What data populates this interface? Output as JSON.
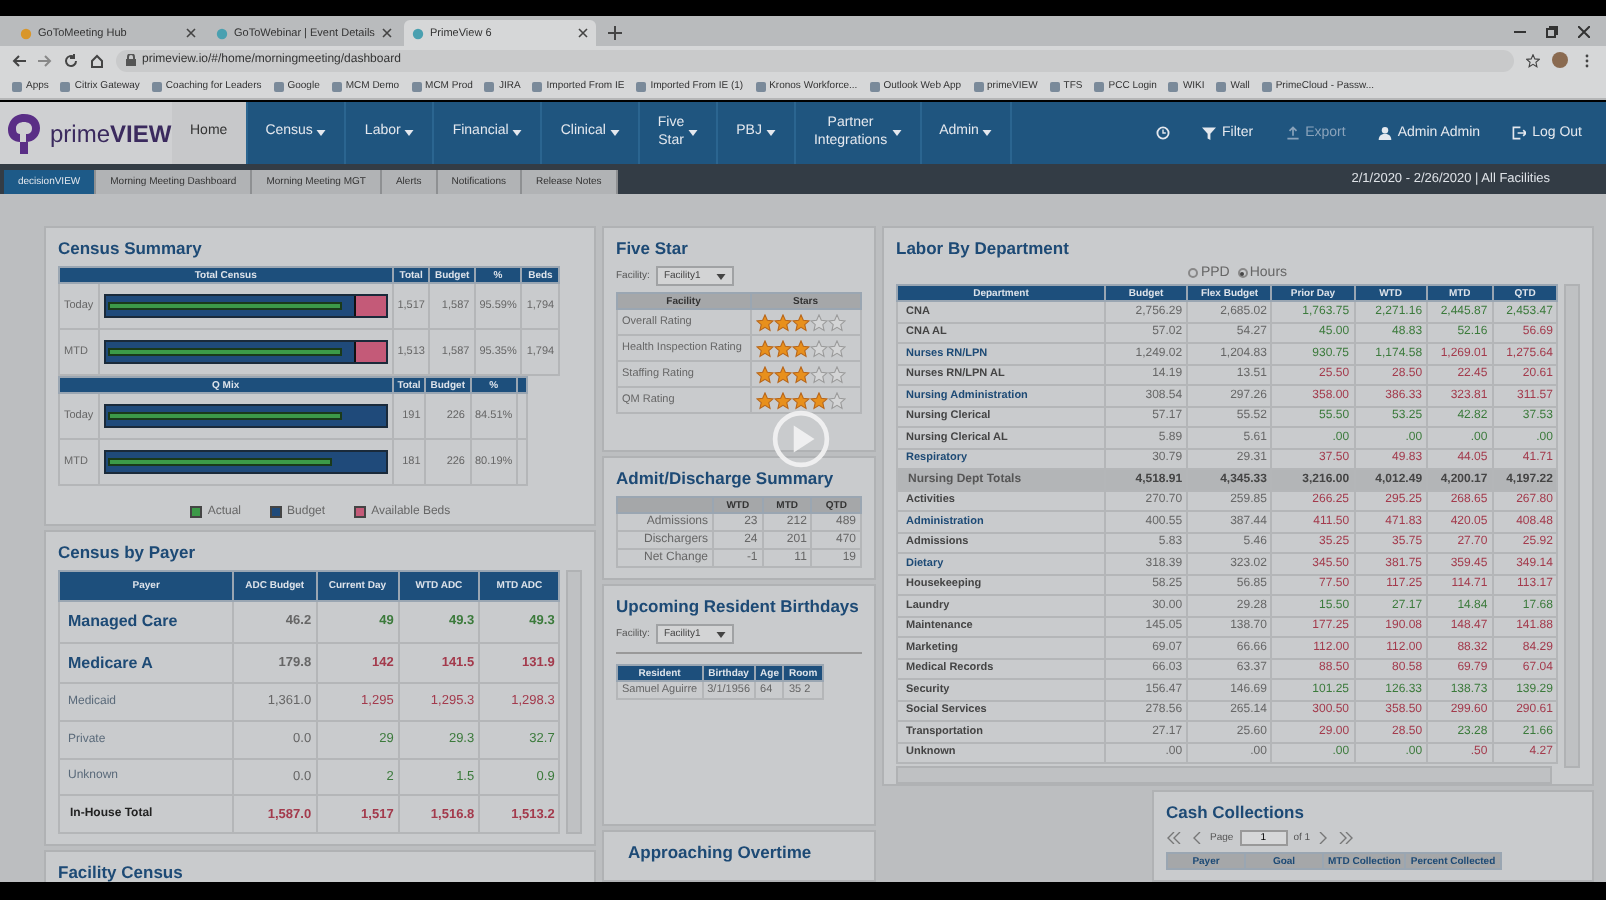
{
  "browser": {
    "tabs": [
      {
        "title": "GoToMeeting Hub",
        "selected": false
      },
      {
        "title": "GoToWebinar | Event Details",
        "selected": false
      },
      {
        "title": "PrimeView 6",
        "selected": true
      }
    ],
    "address": "primeview.io/#/home/morningmeeting/dashboard",
    "bookmarks": [
      "Apps",
      "Citrix Gateway",
      "Coaching for Leaders",
      "Google",
      "MCM Demo",
      "MCM Prod",
      "JIRA",
      "Imported From IE",
      "Imported From IE (1)",
      "Kronos Workforce...",
      "Outlook Web App",
      "primeVIEW",
      "TFS",
      "PCC Login",
      "WIKI",
      "Wall",
      "PrimeCloud - Passw..."
    ]
  },
  "nav": {
    "logo": "prime**VIEW**",
    "items": [
      {
        "label": "Home",
        "selected": true,
        "dropdown": false
      },
      {
        "label": "Census",
        "selected": false,
        "dropdown": true
      },
      {
        "label": "Labor",
        "selected": false,
        "dropdown": true
      },
      {
        "label": "Financial",
        "selected": false,
        "dropdown": true
      },
      {
        "label": "Clinical",
        "selected": false,
        "dropdown": true
      },
      {
        "label": "Five Star",
        "selected": false,
        "dropdown": true
      },
      {
        "label": "PBJ",
        "selected": false,
        "dropdown": true
      },
      {
        "label": "Partner Integrations",
        "selected": false,
        "dropdown": true
      },
      {
        "label": "Admin",
        "selected": false,
        "dropdown": true
      }
    ],
    "actions": [
      {
        "kind": "history",
        "disabled": false
      },
      {
        "kind": "filter",
        "label": "Filter",
        "disabled": false
      },
      {
        "kind": "export",
        "label": "Export",
        "disabled": true
      },
      {
        "kind": "user",
        "label": "Admin Admin",
        "disabled": false
      },
      {
        "kind": "logout",
        "label": "Log Out",
        "disabled": false
      }
    ]
  },
  "subnav": {
    "tabs": [
      {
        "label": "decisionVIEW",
        "selected": true
      },
      {
        "label": "Morning Meeting Dashboard",
        "selected": false
      },
      {
        "label": "Morning Meeting MGT",
        "selected": false
      },
      {
        "label": "Alerts",
        "selected": false
      },
      {
        "label": "Notifications",
        "selected": false
      },
      {
        "label": "Release Notes",
        "selected": false
      }
    ],
    "range": "2/1/2020 - 2/26/2020 | All Facilities"
  },
  "census_summary": {
    "title": "Census Summary",
    "sections": [
      {
        "columns": [
          "Total Census",
          "Total",
          "Budget",
          "%",
          "Beds"
        ],
        "rows": [
          {
            "label": "Today",
            "level": 0.84,
            "budget": {
              "level": 0.885
            },
            "values": [
              "1,517",
              "1,587",
              "95.59%",
              "1,794"
            ]
          },
          {
            "label": "MTD",
            "level": 0.84,
            "budget": {
              "level": 0.885
            },
            "values": [
              "1,513",
              "1,587",
              "95.35%",
              "1,794"
            ]
          }
        ]
      },
      {
        "columns": [
          "Q Mix",
          "Total",
          "Budget",
          "%"
        ],
        "rows": [
          {
            "label": "Today",
            "level": 0.84,
            "values": [
              "191",
              "226",
              "84.51%"
            ]
          },
          {
            "label": "MTD",
            "level": 0.8,
            "values": [
              "181",
              "226",
              "80.19%"
            ]
          }
        ]
      }
    ],
    "legend": [
      {
        "label": "Actual",
        "color": "#3c9a48"
      },
      {
        "label": "Budget",
        "color": "#1f4a7a"
      },
      {
        "label": "Available Beds",
        "color": "#c45a78"
      }
    ]
  },
  "census_by_payer": {
    "title": "Census by Payer",
    "label_column": "Payer",
    "columns": [
      "ADC Budget",
      "Current Day",
      "WTD ADC",
      "MTD ADC"
    ],
    "rows": [
      {
        "kind": "major",
        "label": "Managed Care",
        "cells": [
          {
            "text": "46.2",
            "color": "#666666"
          },
          {
            "text": "49",
            "color": "#3b7a3b"
          },
          {
            "text": "49.3",
            "color": "#3b7a3b"
          },
          {
            "text": "49.3",
            "color": "#3b7a3b"
          }
        ]
      },
      {
        "kind": "major",
        "label": "Medicare A",
        "cells": [
          {
            "text": "179.8",
            "color": "#666666"
          },
          {
            "text": "142",
            "color": "#a33a4c"
          },
          {
            "text": "141.5",
            "color": "#a33a4c"
          },
          {
            "text": "131.9",
            "color": "#a33a4c"
          }
        ]
      },
      {
        "kind": "minor",
        "label": "Medicaid",
        "cells": [
          {
            "text": "1,361.0",
            "color": "#666666"
          },
          {
            "text": "1,295",
            "color": "#a33a4c"
          },
          {
            "text": "1,295.3",
            "color": "#a33a4c"
          },
          {
            "text": "1,298.3",
            "color": "#a33a4c"
          }
        ]
      },
      {
        "kind": "minor",
        "label": "Private",
        "cells": [
          {
            "text": "0.0",
            "color": "#666666"
          },
          {
            "text": "29",
            "color": "#3b7a3b"
          },
          {
            "text": "29.3",
            "color": "#3b7a3b"
          },
          {
            "text": "32.7",
            "color": "#3b7a3b"
          }
        ]
      },
      {
        "kind": "minor",
        "label": "Unknown",
        "cells": [
          {
            "text": "0.0",
            "color": "#666666"
          },
          {
            "text": "2",
            "color": "#3b7a3b"
          },
          {
            "text": "1.5",
            "color": "#3b7a3b"
          },
          {
            "text": "0.9",
            "color": "#3b7a3b"
          }
        ]
      },
      {
        "kind": "total",
        "label": "In-House Total",
        "cells": [
          {
            "text": "1,587.0",
            "color": "#a33a4c"
          },
          {
            "text": "1,517",
            "color": "#a33a4c"
          },
          {
            "text": "1,516.8",
            "color": "#a33a4c"
          },
          {
            "text": "1,513.2",
            "color": "#a33a4c"
          }
        ]
      }
    ]
  },
  "facility_census": {
    "title": "Facility Census"
  },
  "five_star": {
    "title": "Five Star",
    "facility_label": "Facility:",
    "facility": "Facility1",
    "columns": [
      "Facility",
      "Stars"
    ],
    "rows": [
      {
        "label": "Overall Rating",
        "stars": 3
      },
      {
        "label": "Health Inspection Rating",
        "stars": 3
      },
      {
        "label": "Staffing Rating",
        "stars": 3
      },
      {
        "label": "QM Rating",
        "stars": 4
      }
    ]
  },
  "admit_discharge": {
    "title": "Admit/Discharge Summary",
    "columns": [
      "WTD",
      "MTD",
      "QTD"
    ],
    "rows": [
      {
        "label": "Admissions",
        "values": [
          "23",
          "212",
          "489"
        ]
      },
      {
        "label": "Dischargers",
        "values": [
          "24",
          "201",
          "470"
        ]
      },
      {
        "label": "Net Change",
        "values": [
          "-1",
          "11",
          "19"
        ]
      }
    ]
  },
  "birthdays": {
    "title": "Upcoming Resident Birthdays",
    "facility_label": "Facility:",
    "facility": "Facility1",
    "columns": [
      "Resident",
      "Birthday",
      "Age",
      "Room"
    ],
    "rows": [
      [
        "Samuel Aguirre",
        "3/1/1956",
        "64",
        "35 2"
      ]
    ]
  },
  "approaching_overtime": {
    "title": "Approaching Overtime"
  },
  "labor": {
    "title": "Labor By Department",
    "options": [
      {
        "label": "PPD",
        "selected": false
      },
      {
        "label": "Hours",
        "selected": true
      }
    ],
    "label_column": "Department",
    "columns": [
      "Budget",
      "Flex Budget",
      "Prior Day",
      "WTD",
      "MTD",
      "QTD"
    ],
    "rows": [
      {
        "kind": "dept",
        "label": "CNA",
        "cells": [
          {
            "text": "2,756.29",
            "color": "#666666"
          },
          {
            "text": "2,685.02",
            "color": "#666666"
          },
          {
            "text": "1,763.75",
            "color": "#3b7a3b"
          },
          {
            "text": "2,271.16",
            "color": "#3b7a3b"
          },
          {
            "text": "2,445.87",
            "color": "#3b7a3b"
          },
          {
            "text": "2,453.47",
            "color": "#3b7a3b"
          }
        ]
      },
      {
        "kind": "dept",
        "label": "CNA AL",
        "cells": [
          {
            "text": "57.02",
            "color": "#666666"
          },
          {
            "text": "54.27",
            "color": "#666666"
          },
          {
            "text": "45.00",
            "color": "#3b7a3b"
          },
          {
            "text": "48.83",
            "color": "#3b7a3b"
          },
          {
            "text": "52.16",
            "color": "#3b7a3b"
          },
          {
            "text": "56.69",
            "color": "#a33a4c"
          }
        ]
      },
      {
        "kind": "link",
        "label": "Nurses RN/LPN",
        "cells": [
          {
            "text": "1,249.02",
            "color": "#666666"
          },
          {
            "text": "1,204.83",
            "color": "#666666"
          },
          {
            "text": "930.75",
            "color": "#3b7a3b"
          },
          {
            "text": "1,174.58",
            "color": "#3b7a3b"
          },
          {
            "text": "1,269.01",
            "color": "#a33a4c"
          },
          {
            "text": "1,275.64",
            "color": "#a33a4c"
          }
        ]
      },
      {
        "kind": "dept",
        "label": "Nurses RN/LPN AL",
        "cells": [
          {
            "text": "14.19",
            "color": "#666666"
          },
          {
            "text": "13.51",
            "color": "#666666"
          },
          {
            "text": "25.50",
            "color": "#a33a4c"
          },
          {
            "text": "28.50",
            "color": "#a33a4c"
          },
          {
            "text": "22.45",
            "color": "#a33a4c"
          },
          {
            "text": "20.61",
            "color": "#a33a4c"
          }
        ]
      },
      {
        "kind": "link",
        "label": "Nursing Administration",
        "cells": [
          {
            "text": "308.54",
            "color": "#666666"
          },
          {
            "text": "297.26",
            "color": "#666666"
          },
          {
            "text": "358.00",
            "color": "#a33a4c"
          },
          {
            "text": "386.33",
            "color": "#a33a4c"
          },
          {
            "text": "323.81",
            "color": "#a33a4c"
          },
          {
            "text": "311.57",
            "color": "#a33a4c"
          }
        ]
      },
      {
        "kind": "dept",
        "label": "Nursing Clerical",
        "cells": [
          {
            "text": "57.17",
            "color": "#666666"
          },
          {
            "text": "55.52",
            "color": "#666666"
          },
          {
            "text": "55.50",
            "color": "#3b7a3b"
          },
          {
            "text": "53.25",
            "color": "#3b7a3b"
          },
          {
            "text": "42.82",
            "color": "#3b7a3b"
          },
          {
            "text": "37.53",
            "color": "#3b7a3b"
          }
        ]
      },
      {
        "kind": "dept",
        "label": "Nursing Clerical AL",
        "cells": [
          {
            "text": "5.89",
            "color": "#666666"
          },
          {
            "text": "5.61",
            "color": "#666666"
          },
          {
            "text": ".00",
            "color": "#3b7a3b"
          },
          {
            "text": ".00",
            "color": "#3b7a3b"
          },
          {
            "text": ".00",
            "color": "#3b7a3b"
          },
          {
            "text": ".00",
            "color": "#3b7a3b"
          }
        ]
      },
      {
        "kind": "link",
        "label": "Respiratory",
        "cells": [
          {
            "text": "30.79",
            "color": "#666666"
          },
          {
            "text": "29.31",
            "color": "#666666"
          },
          {
            "text": "37.50",
            "color": "#a33a4c"
          },
          {
            "text": "49.83",
            "color": "#a33a4c"
          },
          {
            "text": "44.05",
            "color": "#a33a4c"
          },
          {
            "text": "41.71",
            "color": "#a33a4c"
          }
        ]
      },
      {
        "kind": "total",
        "label": "Nursing Dept Totals",
        "cells": [
          {
            "text": "4,518.91",
            "color": "#444444"
          },
          {
            "text": "4,345.33",
            "color": "#444444"
          },
          {
            "text": "3,216.00",
            "color": "#444444"
          },
          {
            "text": "4,012.49",
            "color": "#444444"
          },
          {
            "text": "4,200.17",
            "color": "#444444"
          },
          {
            "text": "4,197.22",
            "color": "#444444"
          }
        ]
      },
      {
        "kind": "dept",
        "label": "Activities",
        "cells": [
          {
            "text": "270.70",
            "color": "#666666"
          },
          {
            "text": "259.85",
            "color": "#666666"
          },
          {
            "text": "266.25",
            "color": "#a33a4c"
          },
          {
            "text": "295.25",
            "color": "#a33a4c"
          },
          {
            "text": "268.65",
            "color": "#a33a4c"
          },
          {
            "text": "267.80",
            "color": "#a33a4c"
          }
        ]
      },
      {
        "kind": "link",
        "label": "Administration",
        "cells": [
          {
            "text": "400.55",
            "color": "#666666"
          },
          {
            "text": "387.44",
            "color": "#666666"
          },
          {
            "text": "411.50",
            "color": "#a33a4c"
          },
          {
            "text": "471.83",
            "color": "#a33a4c"
          },
          {
            "text": "420.05",
            "color": "#a33a4c"
          },
          {
            "text": "408.48",
            "color": "#a33a4c"
          }
        ]
      },
      {
        "kind": "dept",
        "label": "Admissions",
        "cells": [
          {
            "text": "5.83",
            "color": "#666666"
          },
          {
            "text": "5.46",
            "color": "#666666"
          },
          {
            "text": "35.25",
            "color": "#a33a4c"
          },
          {
            "text": "35.75",
            "color": "#a33a4c"
          },
          {
            "text": "27.70",
            "color": "#a33a4c"
          },
          {
            "text": "25.92",
            "color": "#a33a4c"
          }
        ]
      },
      {
        "kind": "link",
        "label": "Dietary",
        "cells": [
          {
            "text": "318.39",
            "color": "#666666"
          },
          {
            "text": "323.02",
            "color": "#666666"
          },
          {
            "text": "345.50",
            "color": "#a33a4c"
          },
          {
            "text": "381.75",
            "color": "#a33a4c"
          },
          {
            "text": "359.45",
            "color": "#a33a4c"
          },
          {
            "text": "349.14",
            "color": "#a33a4c"
          }
        ]
      },
      {
        "kind": "dept",
        "label": "Housekeeping",
        "cells": [
          {
            "text": "58.25",
            "color": "#666666"
          },
          {
            "text": "56.85",
            "color": "#666666"
          },
          {
            "text": "77.50",
            "color": "#a33a4c"
          },
          {
            "text": "117.25",
            "color": "#a33a4c"
          },
          {
            "text": "114.71",
            "color": "#a33a4c"
          },
          {
            "text": "113.17",
            "color": "#a33a4c"
          }
        ]
      },
      {
        "kind": "dept",
        "label": "Laundry",
        "cells": [
          {
            "text": "30.00",
            "color": "#666666"
          },
          {
            "text": "29.28",
            "color": "#666666"
          },
          {
            "text": "15.50",
            "color": "#3b7a3b"
          },
          {
            "text": "27.17",
            "color": "#3b7a3b"
          },
          {
            "text": "14.84",
            "color": "#3b7a3b"
          },
          {
            "text": "17.68",
            "color": "#3b7a3b"
          }
        ]
      },
      {
        "kind": "dept",
        "label": "Maintenance",
        "cells": [
          {
            "text": "145.05",
            "color": "#666666"
          },
          {
            "text": "138.70",
            "color": "#666666"
          },
          {
            "text": "177.25",
            "color": "#a33a4c"
          },
          {
            "text": "190.08",
            "color": "#a33a4c"
          },
          {
            "text": "148.47",
            "color": "#a33a4c"
          },
          {
            "text": "141.88",
            "color": "#a33a4c"
          }
        ]
      },
      {
        "kind": "dept",
        "label": "Marketing",
        "cells": [
          {
            "text": "69.07",
            "color": "#666666"
          },
          {
            "text": "66.66",
            "color": "#666666"
          },
          {
            "text": "112.00",
            "color": "#a33a4c"
          },
          {
            "text": "112.00",
            "color": "#a33a4c"
          },
          {
            "text": "88.32",
            "color": "#a33a4c"
          },
          {
            "text": "84.29",
            "color": "#a33a4c"
          }
        ]
      },
      {
        "kind": "dept",
        "label": "Medical Records",
        "cells": [
          {
            "text": "66.03",
            "color": "#666666"
          },
          {
            "text": "63.37",
            "color": "#666666"
          },
          {
            "text": "88.50",
            "color": "#a33a4c"
          },
          {
            "text": "80.58",
            "color": "#a33a4c"
          },
          {
            "text": "69.79",
            "color": "#a33a4c"
          },
          {
            "text": "67.04",
            "color": "#a33a4c"
          }
        ]
      },
      {
        "kind": "dept",
        "label": "Security",
        "cells": [
          {
            "text": "156.47",
            "color": "#666666"
          },
          {
            "text": "146.69",
            "color": "#666666"
          },
          {
            "text": "101.25",
            "color": "#3b7a3b"
          },
          {
            "text": "126.33",
            "color": "#3b7a3b"
          },
          {
            "text": "138.73",
            "color": "#3b7a3b"
          },
          {
            "text": "139.29",
            "color": "#3b7a3b"
          }
        ]
      },
      {
        "kind": "dept",
        "label": "Social Services",
        "cells": [
          {
            "text": "278.56",
            "color": "#666666"
          },
          {
            "text": "265.14",
            "color": "#666666"
          },
          {
            "text": "300.50",
            "color": "#a33a4c"
          },
          {
            "text": "358.50",
            "color": "#a33a4c"
          },
          {
            "text": "299.60",
            "color": "#a33a4c"
          },
          {
            "text": "290.61",
            "color": "#a33a4c"
          }
        ]
      },
      {
        "kind": "dept",
        "label": "Transportation",
        "cells": [
          {
            "text": "27.17",
            "color": "#666666"
          },
          {
            "text": "25.60",
            "color": "#666666"
          },
          {
            "text": "29.00",
            "color": "#a33a4c"
          },
          {
            "text": "28.50",
            "color": "#a33a4c"
          },
          {
            "text": "23.28",
            "color": "#3b7a3b"
          },
          {
            "text": "21.66",
            "color": "#3b7a3b"
          }
        ]
      },
      {
        "kind": "dept",
        "label": "Unknown",
        "cells": [
          {
            "text": ".00",
            "color": "#666666"
          },
          {
            "text": ".00",
            "color": "#666666"
          },
          {
            "text": ".00",
            "color": "#3b7a3b"
          },
          {
            "text": ".00",
            "color": "#3b7a3b"
          },
          {
            "text": ".50",
            "color": "#a33a4c"
          },
          {
            "text": "4.27",
            "color": "#a33a4c"
          }
        ]
      }
    ]
  },
  "cash_collections": {
    "title": "Cash Collections",
    "page_label": "Page",
    "page": "1",
    "page_count": "of 1",
    "columns": [
      "Payer",
      "Goal",
      "MTD Collection",
      "Percent Collected"
    ]
  }
}
